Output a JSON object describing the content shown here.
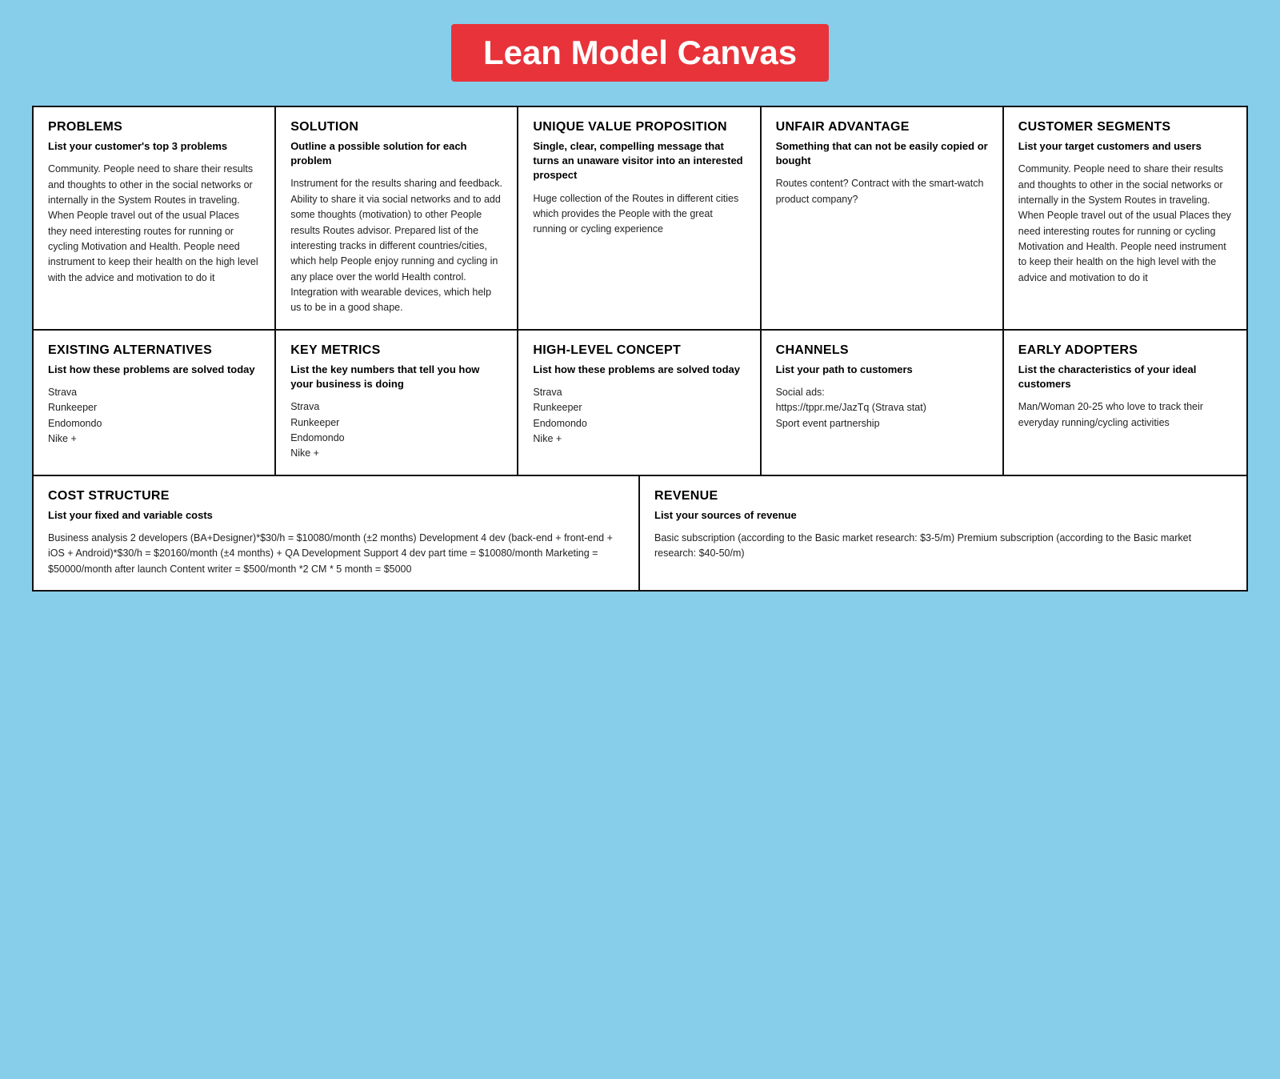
{
  "header": {
    "title": "Lean Model Canvas"
  },
  "cells": {
    "problems": {
      "title": "PROBLEMS",
      "subtitle": "List your customer's top 3 problems",
      "body": "Community. People need to share their results and thoughts to other in the social networks or internally in the System Routes in traveling. When People travel out of the usual Places they need interesting routes for running or cycling Motivation and Health. People need instrument to keep their health on the high level with the advice and motivation to do it"
    },
    "solution": {
      "title": "SOLUTION",
      "subtitle": "Outline a possible solution for each problem",
      "body": "Instrument for the results sharing and feedback. Ability to share it via social networks and to add some thoughts (motivation) to other People results Routes advisor. Prepared list of the interesting tracks in different countries/cities, which help People enjoy running and cycling in any place over the world Health control. Integration with wearable devices, which help us to be in a good shape."
    },
    "unique_value": {
      "title": "UNIQUE VALUE PROPOSITION",
      "subtitle": "Single, clear, compelling message that turns an unaware visitor into an interested prospect",
      "body": "Huge collection of the Routes in different cities which provides the People with the great running or cycling experience"
    },
    "unfair_advantage": {
      "title": "UNFAIR ADVANTAGE",
      "subtitle": "Something that can not be easily copied or bought",
      "body": "Routes content?  Contract with the smart-watch product company?"
    },
    "customer_segments": {
      "title": "CUSTOMER SEGMENTS",
      "subtitle": "List your target customers and users",
      "body": "Community. People need to share their results and thoughts to other in the social networks or internally in the System Routes in traveling. When People travel out of the usual Places they need interesting routes for running or cycling Motivation and Health. People need instrument to keep their health on the high level with the advice and motivation to do it"
    },
    "existing_alternatives": {
      "title": "EXISTING ALTERNATIVES",
      "subtitle": "List how these problems are solved today",
      "body": "Strava\nRunkeeper\nEndomondo\nNike +"
    },
    "key_metrics": {
      "title": "KEY METRICS",
      "subtitle": "List the key numbers that tell you how your business is doing",
      "body": "Strava\nRunkeeper\nEndomondo\nNike +"
    },
    "high_level_concept": {
      "title": "HIGH-LEVEL CONCEPT",
      "subtitle": "List how these problems are solved today",
      "body": "Strava\nRunkeeper\nEndomondo\nNike +"
    },
    "channels": {
      "title": "CHANNELS",
      "subtitle": "List your path to customers",
      "body": "Social ads:\nhttps://tppr.me/JazTq (Strava stat)\nSport event partnership"
    },
    "early_adopters": {
      "title": "EARLY ADOPTERS",
      "subtitle": "List the characteristics of your ideal customers",
      "body": "Man/Woman 20-25 who love to track their everyday running/cycling activities"
    },
    "cost_structure": {
      "title": "COST STRUCTURE",
      "subtitle": "List your fixed and variable costs",
      "body": "Business analysis 2 developers (BA+Designer)*$30/h = $10080/month (±2 months) Development 4 dev (back-end + front-end + iOS + Android)*$30/h = $20160/month (±4 months) + QA Development Support 4 dev part time = $10080/month Marketing = $50000/month after launch  Content writer = $500/month *2 CM * 5 month = $5000"
    },
    "revenue": {
      "title": "REVENUE",
      "subtitle": "List your sources of revenue",
      "body": "Basic subscription (according to the Basic market research: $3-5/m) Premium subscription (according to the Basic market research: $40-50/m)"
    }
  }
}
